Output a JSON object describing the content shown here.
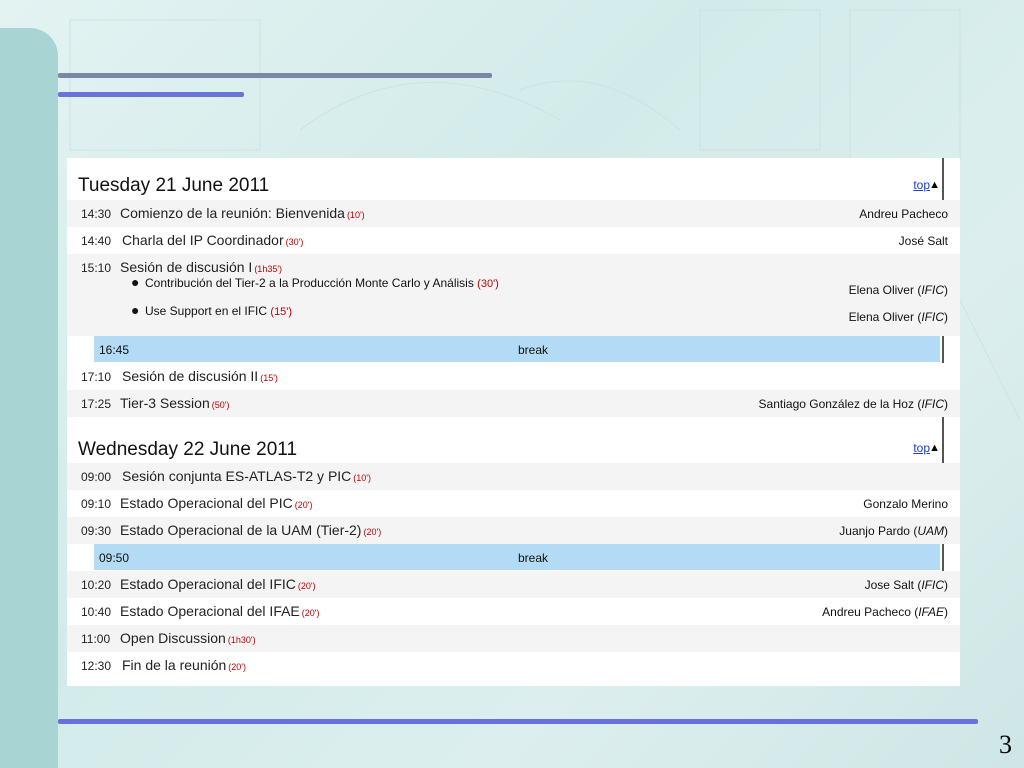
{
  "slide": {
    "page_number": "3"
  },
  "days": [
    {
      "title": "Tuesday 21 June 2011",
      "top_label": "top",
      "items": [
        {
          "time": "14:30",
          "title": "Comienzo de la reunión: Bienvenida",
          "duration": "(10')",
          "speaker": "Andreu Pacheco",
          "affiliation": ""
        },
        {
          "time": "14:40",
          "title": "Charla del IP Coordinador",
          "duration": "(30')",
          "speaker": "José Salt",
          "affiliation": ""
        },
        {
          "time": "15:10",
          "title": "Sesión de discusión I",
          "duration": "(1h35')",
          "contributions": [
            {
              "title": "Contribución del Tier-2 a la Producción Monte Carlo y Análisis",
              "duration": "(30')",
              "speaker": "Elena Oliver",
              "affiliation": "IFIC"
            },
            {
              "title": "Use Support en el IFIC",
              "duration": "(15')",
              "speaker": "Elena Oliver",
              "affiliation": "IFIC"
            }
          ]
        },
        {
          "break": true,
          "time": "16:45",
          "title": "break"
        },
        {
          "time": "17:10",
          "title": "Sesión de discusión II",
          "duration": "(15')",
          "speaker": "",
          "affiliation": ""
        },
        {
          "time": "17:25",
          "title": "Tier-3 Session",
          "duration": "(50')",
          "speaker": "Santiago González de la Hoz",
          "affiliation": "IFIC"
        }
      ]
    },
    {
      "title": "Wednesday 22 June 2011",
      "top_label": "top",
      "items": [
        {
          "time": "09:00",
          "title": "Sesión conjunta ES-ATLAS-T2 y PIC",
          "duration": "(10')",
          "speaker": "",
          "affiliation": ""
        },
        {
          "time": "09:10",
          "title": "Estado Operacional del PIC",
          "duration": "(20')",
          "speaker": "Gonzalo Merino",
          "affiliation": ""
        },
        {
          "time": "09:30",
          "title": "Estado Operacional de la UAM (Tier-2)",
          "duration": "(20')",
          "speaker": "Juanjo Pardo",
          "affiliation": "UAM"
        },
        {
          "break": true,
          "time": "09:50",
          "title": "break"
        },
        {
          "time": "10:20",
          "title": "Estado Operacional del IFIC",
          "duration": "(20')",
          "speaker": "Jose Salt",
          "affiliation": "IFIC"
        },
        {
          "time": "10:40",
          "title": "Estado Operacional del IFAE",
          "duration": "(20')",
          "speaker": "Andreu Pacheco",
          "affiliation": "IFAE"
        },
        {
          "time": "11:00",
          "title": "Open Discussion",
          "duration": "(1h30')",
          "speaker": "",
          "affiliation": ""
        },
        {
          "time": "12:30",
          "title": "Fin de la reunión",
          "duration": "(20')",
          "speaker": "",
          "affiliation": ""
        }
      ]
    }
  ]
}
